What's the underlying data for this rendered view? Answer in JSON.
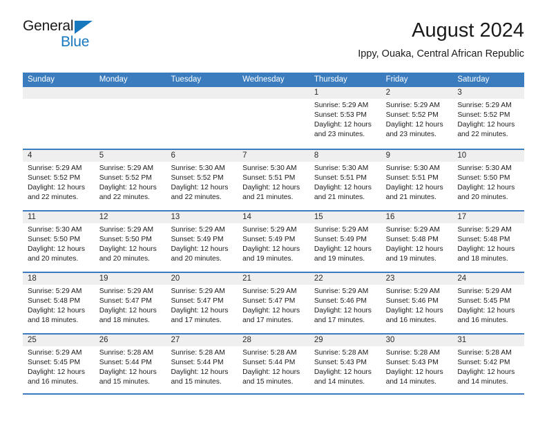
{
  "brand": {
    "word1": "General",
    "word2": "Blue",
    "triangle_color": "#1878be",
    "logo_icon": "general-blue-logo-icon"
  },
  "header": {
    "month_title": "August 2024",
    "location": "Ippy, Ouaka, Central African Republic"
  },
  "theme": {
    "header_blue": "#3a7cbe",
    "day_band_gray": "#efefef",
    "text": "#1a1a1a"
  },
  "calendar": {
    "day_names": [
      "Sunday",
      "Monday",
      "Tuesday",
      "Wednesday",
      "Thursday",
      "Friday",
      "Saturday"
    ],
    "weeks": [
      [
        {
          "day": "",
          "lines": []
        },
        {
          "day": "",
          "lines": []
        },
        {
          "day": "",
          "lines": []
        },
        {
          "day": "",
          "lines": []
        },
        {
          "day": "1",
          "lines": [
            "Sunrise: 5:29 AM",
            "Sunset: 5:53 PM",
            "Daylight: 12 hours",
            "and 23 minutes."
          ]
        },
        {
          "day": "2",
          "lines": [
            "Sunrise: 5:29 AM",
            "Sunset: 5:52 PM",
            "Daylight: 12 hours",
            "and 23 minutes."
          ]
        },
        {
          "day": "3",
          "lines": [
            "Sunrise: 5:29 AM",
            "Sunset: 5:52 PM",
            "Daylight: 12 hours",
            "and 22 minutes."
          ]
        }
      ],
      [
        {
          "day": "4",
          "lines": [
            "Sunrise: 5:29 AM",
            "Sunset: 5:52 PM",
            "Daylight: 12 hours",
            "and 22 minutes."
          ]
        },
        {
          "day": "5",
          "lines": [
            "Sunrise: 5:29 AM",
            "Sunset: 5:52 PM",
            "Daylight: 12 hours",
            "and 22 minutes."
          ]
        },
        {
          "day": "6",
          "lines": [
            "Sunrise: 5:30 AM",
            "Sunset: 5:52 PM",
            "Daylight: 12 hours",
            "and 22 minutes."
          ]
        },
        {
          "day": "7",
          "lines": [
            "Sunrise: 5:30 AM",
            "Sunset: 5:51 PM",
            "Daylight: 12 hours",
            "and 21 minutes."
          ]
        },
        {
          "day": "8",
          "lines": [
            "Sunrise: 5:30 AM",
            "Sunset: 5:51 PM",
            "Daylight: 12 hours",
            "and 21 minutes."
          ]
        },
        {
          "day": "9",
          "lines": [
            "Sunrise: 5:30 AM",
            "Sunset: 5:51 PM",
            "Daylight: 12 hours",
            "and 21 minutes."
          ]
        },
        {
          "day": "10",
          "lines": [
            "Sunrise: 5:30 AM",
            "Sunset: 5:50 PM",
            "Daylight: 12 hours",
            "and 20 minutes."
          ]
        }
      ],
      [
        {
          "day": "11",
          "lines": [
            "Sunrise: 5:30 AM",
            "Sunset: 5:50 PM",
            "Daylight: 12 hours",
            "and 20 minutes."
          ]
        },
        {
          "day": "12",
          "lines": [
            "Sunrise: 5:29 AM",
            "Sunset: 5:50 PM",
            "Daylight: 12 hours",
            "and 20 minutes."
          ]
        },
        {
          "day": "13",
          "lines": [
            "Sunrise: 5:29 AM",
            "Sunset: 5:49 PM",
            "Daylight: 12 hours",
            "and 20 minutes."
          ]
        },
        {
          "day": "14",
          "lines": [
            "Sunrise: 5:29 AM",
            "Sunset: 5:49 PM",
            "Daylight: 12 hours",
            "and 19 minutes."
          ]
        },
        {
          "day": "15",
          "lines": [
            "Sunrise: 5:29 AM",
            "Sunset: 5:49 PM",
            "Daylight: 12 hours",
            "and 19 minutes."
          ]
        },
        {
          "day": "16",
          "lines": [
            "Sunrise: 5:29 AM",
            "Sunset: 5:48 PM",
            "Daylight: 12 hours",
            "and 19 minutes."
          ]
        },
        {
          "day": "17",
          "lines": [
            "Sunrise: 5:29 AM",
            "Sunset: 5:48 PM",
            "Daylight: 12 hours",
            "and 18 minutes."
          ]
        }
      ],
      [
        {
          "day": "18",
          "lines": [
            "Sunrise: 5:29 AM",
            "Sunset: 5:48 PM",
            "Daylight: 12 hours",
            "and 18 minutes."
          ]
        },
        {
          "day": "19",
          "lines": [
            "Sunrise: 5:29 AM",
            "Sunset: 5:47 PM",
            "Daylight: 12 hours",
            "and 18 minutes."
          ]
        },
        {
          "day": "20",
          "lines": [
            "Sunrise: 5:29 AM",
            "Sunset: 5:47 PM",
            "Daylight: 12 hours",
            "and 17 minutes."
          ]
        },
        {
          "day": "21",
          "lines": [
            "Sunrise: 5:29 AM",
            "Sunset: 5:47 PM",
            "Daylight: 12 hours",
            "and 17 minutes."
          ]
        },
        {
          "day": "22",
          "lines": [
            "Sunrise: 5:29 AM",
            "Sunset: 5:46 PM",
            "Daylight: 12 hours",
            "and 17 minutes."
          ]
        },
        {
          "day": "23",
          "lines": [
            "Sunrise: 5:29 AM",
            "Sunset: 5:46 PM",
            "Daylight: 12 hours",
            "and 16 minutes."
          ]
        },
        {
          "day": "24",
          "lines": [
            "Sunrise: 5:29 AM",
            "Sunset: 5:45 PM",
            "Daylight: 12 hours",
            "and 16 minutes."
          ]
        }
      ],
      [
        {
          "day": "25",
          "lines": [
            "Sunrise: 5:29 AM",
            "Sunset: 5:45 PM",
            "Daylight: 12 hours",
            "and 16 minutes."
          ]
        },
        {
          "day": "26",
          "lines": [
            "Sunrise: 5:28 AM",
            "Sunset: 5:44 PM",
            "Daylight: 12 hours",
            "and 15 minutes."
          ]
        },
        {
          "day": "27",
          "lines": [
            "Sunrise: 5:28 AM",
            "Sunset: 5:44 PM",
            "Daylight: 12 hours",
            "and 15 minutes."
          ]
        },
        {
          "day": "28",
          "lines": [
            "Sunrise: 5:28 AM",
            "Sunset: 5:44 PM",
            "Daylight: 12 hours",
            "and 15 minutes."
          ]
        },
        {
          "day": "29",
          "lines": [
            "Sunrise: 5:28 AM",
            "Sunset: 5:43 PM",
            "Daylight: 12 hours",
            "and 14 minutes."
          ]
        },
        {
          "day": "30",
          "lines": [
            "Sunrise: 5:28 AM",
            "Sunset: 5:43 PM",
            "Daylight: 12 hours",
            "and 14 minutes."
          ]
        },
        {
          "day": "31",
          "lines": [
            "Sunrise: 5:28 AM",
            "Sunset: 5:42 PM",
            "Daylight: 12 hours",
            "and 14 minutes."
          ]
        }
      ]
    ]
  }
}
